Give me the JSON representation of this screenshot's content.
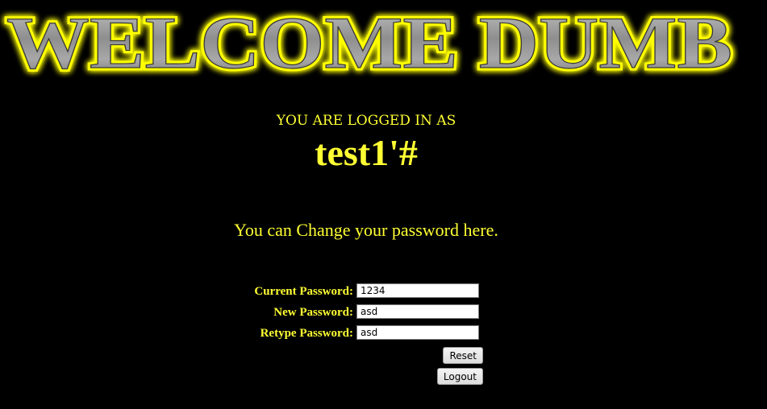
{
  "banner": {
    "text": "WELCOME DUMB"
  },
  "session": {
    "logged_in_label": "YOU ARE LOGGED IN AS",
    "username": "test1'#"
  },
  "message": "You can Change your password here.",
  "form": {
    "current_password": {
      "label": "Current Password:",
      "value": "1234"
    },
    "new_password": {
      "label": "New Password:",
      "value": "asd"
    },
    "retype_password": {
      "label": "Retype Password:",
      "value": "asd"
    },
    "reset_label": "Reset",
    "logout_label": "Logout"
  },
  "colors": {
    "background": "#000000",
    "text": "#ffff33",
    "banner_glow": "#ffff00",
    "banner_metal": "#9a9a9a"
  }
}
